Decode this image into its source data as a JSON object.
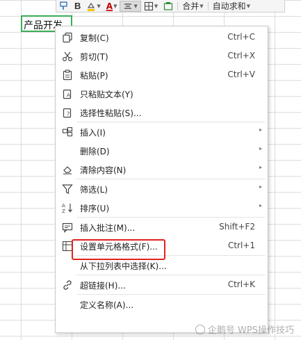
{
  "cell": {
    "a1_text": "产品开发"
  },
  "toolbar": {
    "bold_label": "B",
    "font_color_label": "A",
    "merge_label": "合并",
    "autosum_label": "自动求和"
  },
  "menu": {
    "items": [
      {
        "label": "复制(C)",
        "shortcut": "Ctrl+C"
      },
      {
        "label": "剪切(T)",
        "shortcut": "Ctrl+X"
      },
      {
        "label": "粘贴(P)",
        "shortcut": "Ctrl+V"
      },
      {
        "label": "只粘贴文本(Y)",
        "shortcut": ""
      },
      {
        "label": "选择性粘贴(S)...",
        "shortcut": ""
      },
      {
        "label": "插入(I)",
        "shortcut": ""
      },
      {
        "label": "删除(D)",
        "shortcut": ""
      },
      {
        "label": "清除内容(N)",
        "shortcut": ""
      },
      {
        "label": "筛选(L)",
        "shortcut": ""
      },
      {
        "label": "排序(U)",
        "shortcut": ""
      },
      {
        "label": "插入批注(M)...",
        "shortcut": "Shift+F2"
      },
      {
        "label": "设置单元格格式(F)...",
        "shortcut": "Ctrl+1"
      },
      {
        "label": "从下拉列表中选择(K)...",
        "shortcut": ""
      },
      {
        "label": "超链接(H)...",
        "shortcut": "Ctrl+K"
      },
      {
        "label": "定义名称(A)...",
        "shortcut": ""
      }
    ],
    "submenu_arrow": "▸"
  },
  "watermark": {
    "text": "企鹅号 WPS操作技巧"
  },
  "colors": {
    "selection": "#3cac55",
    "highlight": "#e0221d"
  }
}
